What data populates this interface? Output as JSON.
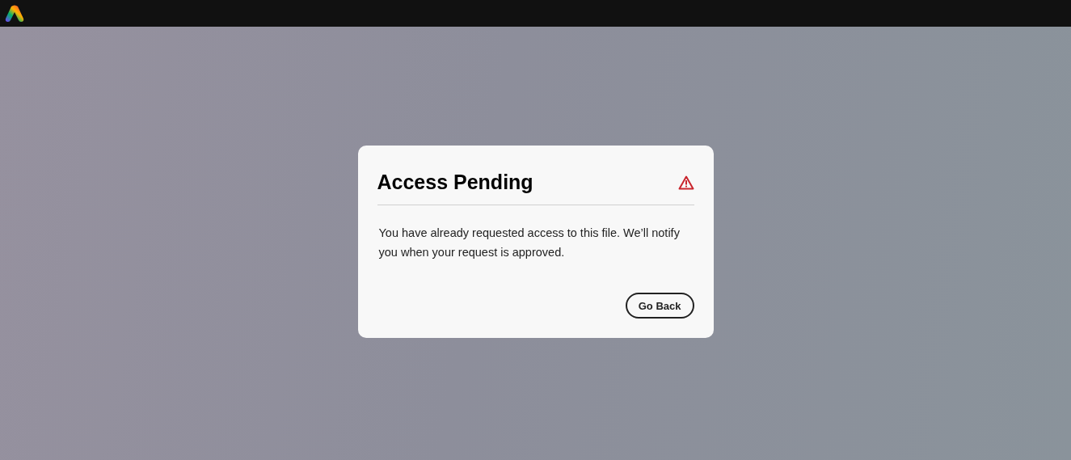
{
  "dialog": {
    "title": "Access Pending",
    "message": "You have already requested access to this file. We’ll notify you when your request is approved.",
    "buttons": [
      {
        "label": "Go Back"
      }
    ]
  }
}
